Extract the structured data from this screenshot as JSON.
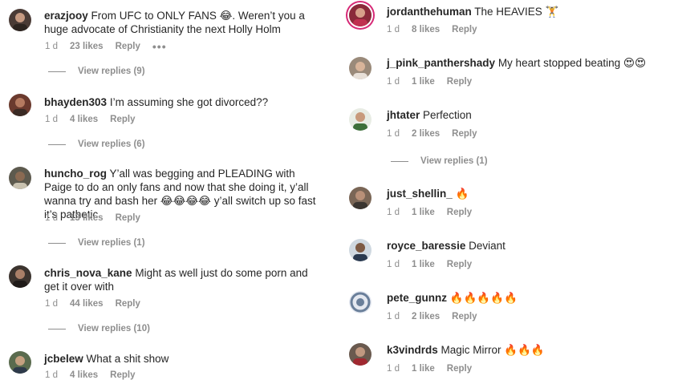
{
  "left": [
    {
      "user": "erazjooy",
      "text": "From UFC to ONLY FANS 😂. Weren’t you a huge advocate of Christianity the next Holly Holm",
      "time": "1 d",
      "likes": "23 likes",
      "reply": "Reply",
      "more": "•••",
      "view_replies": "View replies (9)",
      "avatar_color": "#4a3b36"
    },
    {
      "user": "bhayden303",
      "text": "I’m assuming she got divorced??",
      "time": "1 d",
      "likes": "4 likes",
      "reply": "Reply",
      "view_replies": "View replies (6)",
      "avatar_color": "#6b3a2e"
    },
    {
      "user": "huncho_rog",
      "text": "Y’all was begging and PLEADING with Paige to do an only fans and now that she doing it, y’all wanna try and bash her 😂😂😂😂 y’all switch up so fast it’s pathetic",
      "time": "1 d",
      "likes": "13 likes",
      "reply": "Reply",
      "view_replies": "View replies (1)",
      "avatar_color": "#5d5a4e"
    },
    {
      "user": "chris_nova_kane",
      "text": "Might as well just do some porn and get it over with",
      "time": "1 d",
      "likes": "44 likes",
      "reply": "Reply",
      "view_replies": "View replies (10)",
      "avatar_color": "#3c342f"
    },
    {
      "user": "jcbelew",
      "text": "What a shit show",
      "time": "1 d",
      "likes": "4 likes",
      "reply": "Reply",
      "avatar_color": "#5a6b4e"
    }
  ],
  "right": [
    {
      "user": "jordanthehuman",
      "text": "The HEAVIES 🏋️",
      "time": "1 d",
      "likes": "8 likes",
      "reply": "Reply",
      "avatar_color": "#8a2a3a"
    },
    {
      "user": "j_pink_panthershady",
      "text": "My heart stopped beating 😍😍",
      "time": "1 d",
      "likes": "1 like",
      "reply": "Reply",
      "avatar_color": "#9a8a7a"
    },
    {
      "user": "jhtater",
      "text": "Perfection",
      "time": "1 d",
      "likes": "2 likes",
      "reply": "Reply",
      "view_replies": "View replies (1)",
      "avatar_color": "#3d6f3a"
    },
    {
      "user": "just_shellin_",
      "text": "🔥",
      "time": "1 d",
      "likes": "1 like",
      "reply": "Reply",
      "avatar_color": "#7a6656"
    },
    {
      "user": "royce_baressie",
      "text": "Deviant",
      "time": "1 d",
      "likes": "1 like",
      "reply": "Reply",
      "avatar_color": "#7d5a44"
    },
    {
      "user": "pete_gunnz",
      "text": "🔥🔥🔥🔥🔥",
      "time": "1 d",
      "likes": "2 likes",
      "reply": "Reply",
      "avatar_color": "#6a7f9a"
    },
    {
      "user": "k3vindrds",
      "text": "Magic Mirror 🔥🔥🔥",
      "time": "1 d",
      "likes": "1 like",
      "reply": "Reply",
      "avatar_color": "#6a5a4f"
    }
  ]
}
